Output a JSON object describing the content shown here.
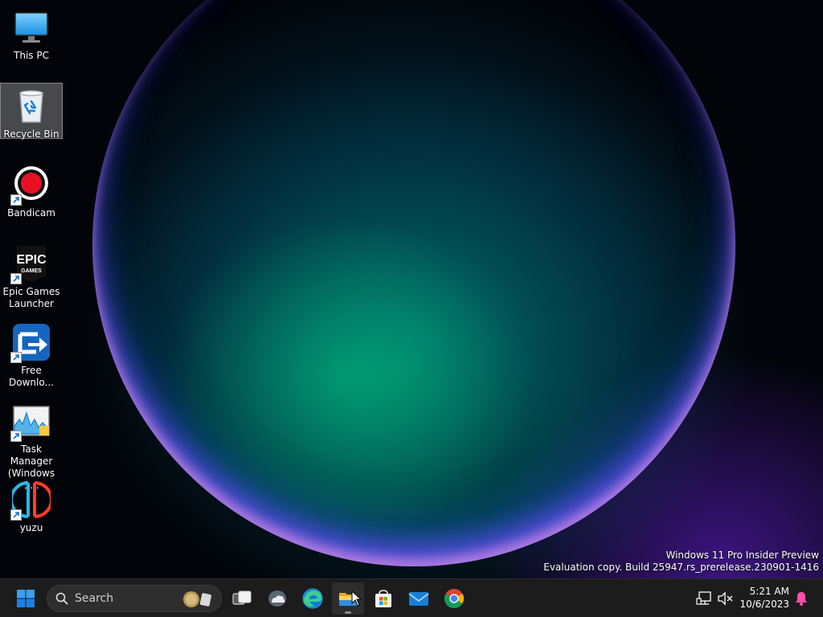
{
  "desktop": {
    "icons": [
      {
        "label": "This PC",
        "icon": "monitor-icon"
      },
      {
        "label": "Recycle Bin",
        "icon": "recycle-bin-icon",
        "selected": true
      },
      {
        "label": "Bandicam",
        "icon": "bandicam-icon",
        "shortcut": true
      },
      {
        "label": "Epic Games Launcher",
        "icon": "epic-games-icon",
        "shortcut": true,
        "logo_text": "EPIC",
        "logo_subtext": "GAMES"
      },
      {
        "label": "Free Downlo...",
        "icon": "free-download-manager-icon",
        "shortcut": true
      },
      {
        "label": "Task Manager (Windows 1...",
        "icon": "task-manager-icon",
        "shortcut": true
      },
      {
        "label": "yuzu",
        "icon": "yuzu-icon",
        "shortcut": true
      }
    ],
    "watermark": {
      "line1": "Windows 11 Pro Insider Preview",
      "line2": "Evaluation copy. Build 25947.rs_prerelease.230901-1416"
    }
  },
  "taskbar": {
    "start_icon": "windows-start-icon",
    "search_placeholder": "Search",
    "pinned": [
      {
        "name": "task-view-icon"
      },
      {
        "name": "widgets-icon"
      },
      {
        "name": "edge-icon"
      },
      {
        "name": "file-explorer-icon",
        "active": true
      },
      {
        "name": "microsoft-store-icon"
      },
      {
        "name": "mail-icon"
      },
      {
        "name": "chrome-icon"
      }
    ],
    "tray": {
      "network_icon": "network-icon",
      "volume_icon": "volume-muted-icon",
      "time": "5:21 AM",
      "date": "10/6/2023",
      "notification_icon": "notification-bell-icon"
    }
  },
  "colors": {
    "taskbar_bg": "#1c1c1c",
    "windows_blue": "#0078d4",
    "bandicam_red": "#e81123",
    "accent_notification": "#ff4fa7"
  }
}
